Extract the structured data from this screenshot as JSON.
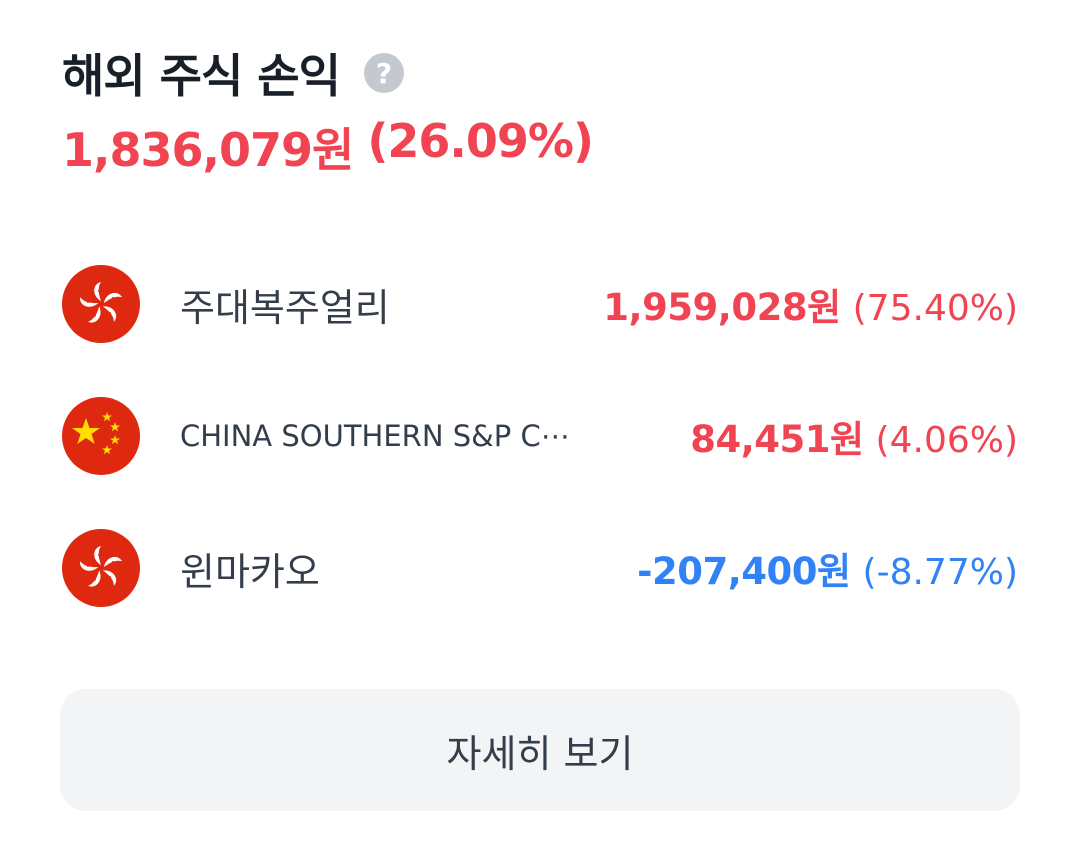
{
  "header": {
    "title": "해외 주식 손익",
    "help_icon": "question-mark-icon",
    "total_amount": "1,836,079원",
    "total_percent": "(26.09%)"
  },
  "stocks": [
    {
      "flag": "hong-kong-flag-icon",
      "name": "주대복주얼리",
      "amount": "1,959,028원",
      "percent": "(75.40%)",
      "direction": "up"
    },
    {
      "flag": "china-flag-icon",
      "name": "CHINA SOUTHERN S&P C⋯",
      "amount": "84,451원",
      "percent": "(4.06%)",
      "direction": "up"
    },
    {
      "flag": "hong-kong-flag-icon",
      "name": "윈마카오",
      "amount": "-207,400원",
      "percent": "(-8.77%)",
      "direction": "down"
    }
  ],
  "detail_button": {
    "label": "자세히 보기"
  },
  "colors": {
    "positive": "#f04452",
    "negative": "#3182f6",
    "button_bg": "#f2f4f6"
  }
}
